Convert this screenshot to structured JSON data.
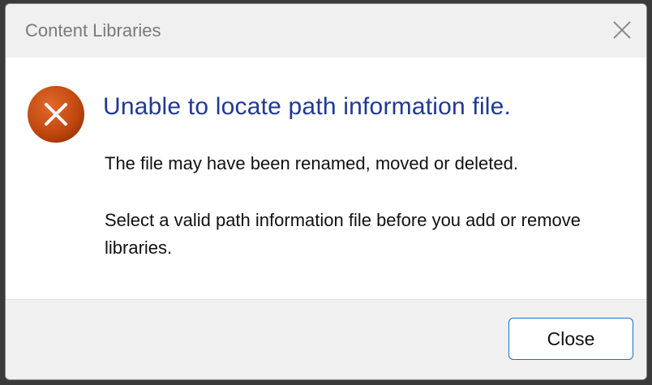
{
  "window": {
    "title": "Content Libraries",
    "close_icon": "close-icon"
  },
  "message": {
    "icon": "error-icon",
    "heading": "Unable to locate path information file.",
    "line1": "The file  may have been renamed, moved or deleted.",
    "line2": "Select a valid path information file before you add or remove libraries."
  },
  "footer": {
    "close_label": "Close"
  },
  "colors": {
    "heading": "#1f3a93",
    "error_icon": "#c1470f",
    "button_border": "#1a6fd1"
  }
}
